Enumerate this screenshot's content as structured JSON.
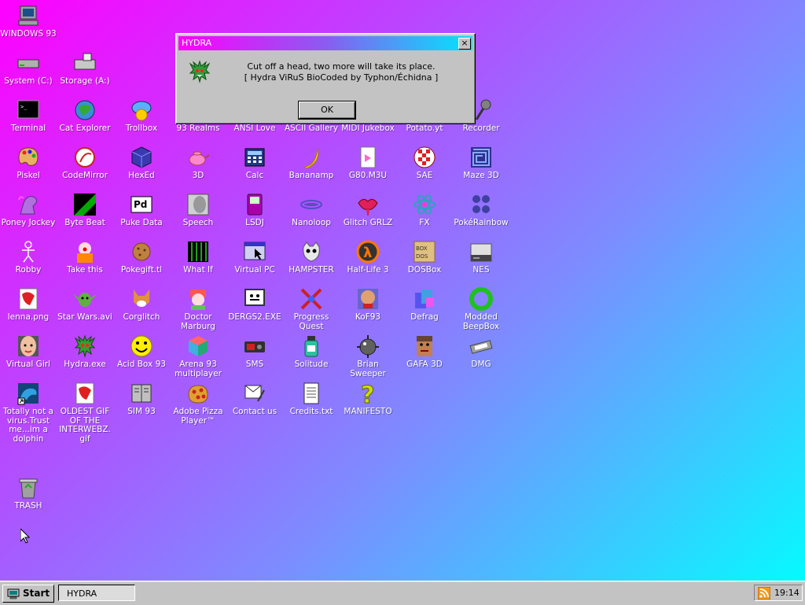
{
  "desktop": {
    "icons": [
      {
        "label": "WINDOWS 93",
        "icon": "computer-icon",
        "color": "#9aa0a6"
      },
      {
        "label": "System (C:)",
        "icon": "hard-drive-icon",
        "color": "#b0b0b0"
      },
      {
        "label": "Storage (A:)",
        "icon": "floppy-drive-icon",
        "color": "#c8c8c8"
      },
      {
        "label": "Terminal",
        "icon": "terminal-icon",
        "color": "#000000"
      },
      {
        "label": "Cat Explorer",
        "icon": "cat-globe-icon",
        "color": "#3b8fd9"
      },
      {
        "label": "Trollbox",
        "icon": "chat-bubble-icon",
        "color": "#ffcc00"
      },
      {
        "label": "93 Realms",
        "icon": "realms-icon",
        "color": "#6a5acd"
      },
      {
        "label": "ANSI Love",
        "icon": "ansi-icon",
        "color": "#ff5555"
      },
      {
        "label": "ASCII Gallery",
        "icon": "ascii-icon",
        "color": "#55aa55"
      },
      {
        "label": "MIDI Jukebox",
        "icon": "jukebox-icon",
        "color": "#aa55ff"
      },
      {
        "label": "Potato.yt",
        "icon": "potato-icon",
        "color": "#c89a5a"
      },
      {
        "label": "Recorder",
        "icon": "microphone-icon",
        "color": "#808080"
      },
      {
        "label": "Piskel",
        "icon": "palette-icon",
        "color": "#e8b060"
      },
      {
        "label": "CodeMirror",
        "icon": "codemirror-icon",
        "color": "#ffffff"
      },
      {
        "label": "HexEd",
        "icon": "cube-icon",
        "color": "#3a3ab0"
      },
      {
        "label": "3D",
        "icon": "teapot-icon",
        "color": "#ff88cc"
      },
      {
        "label": "Calc",
        "icon": "calculator-icon",
        "color": "#203a80"
      },
      {
        "label": "Bananamp",
        "icon": "banana-icon",
        "color": "#ffd700"
      },
      {
        "label": "G80.M3U",
        "icon": "music-file-icon",
        "color": "#ff66cc"
      },
      {
        "label": "SAE",
        "icon": "amiga-ball-icon",
        "color": "#e02020"
      },
      {
        "label": "Maze 3D",
        "icon": "maze-icon",
        "color": "#303090"
      },
      {
        "label": "Poney Jockey",
        "icon": "pony-icon",
        "color": "#b070e0"
      },
      {
        "label": "Byte Beat",
        "icon": "bytebeat-icon",
        "color": "#00aa00"
      },
      {
        "label": "Puke Data",
        "icon": "pd-icon",
        "color": "#ffffff"
      },
      {
        "label": "Speech",
        "icon": "face-icon",
        "color": "#d0d0d0"
      },
      {
        "label": "LSDJ",
        "icon": "gameboy-icon",
        "color": "#aa00aa"
      },
      {
        "label": "Nanoloop",
        "icon": "nanoloop-icon",
        "color": "#5050c0"
      },
      {
        "label": "Glitch GRLZ",
        "icon": "lips-icon",
        "color": "#e0205a"
      },
      {
        "label": "FX",
        "icon": "atom-icon",
        "color": "#30a0c0"
      },
      {
        "label": "PokéRainbow",
        "icon": "pokemon-icon",
        "color": "#4040a0"
      },
      {
        "label": "Robby",
        "icon": "stick-figure-icon",
        "color": "#ffffff"
      },
      {
        "label": "Take this",
        "icon": "clown-icon",
        "color": "#ff8800"
      },
      {
        "label": "Pokegift.tl",
        "icon": "cookie-icon",
        "color": "#c08040"
      },
      {
        "label": "What If",
        "icon": "matrix-icon",
        "color": "#20a020"
      },
      {
        "label": "Virtual PC",
        "icon": "window-cursor-icon",
        "color": "#d0d0f0"
      },
      {
        "label": "HAMPSTER",
        "icon": "hamster-icon",
        "color": "#e8e8e8"
      },
      {
        "label": "Half-Life 3",
        "icon": "lambda-icon",
        "color": "#ff7700"
      },
      {
        "label": "DOSBox",
        "icon": "dosbox-icon",
        "color": "#e0c080"
      },
      {
        "label": "NES",
        "icon": "nes-icon",
        "color": "#e0e0e0"
      },
      {
        "label": "lenna.png",
        "icon": "image-file-icon",
        "color": "#e02020"
      },
      {
        "label": "Star Wars.avi",
        "icon": "yoda-icon",
        "color": "#60b040"
      },
      {
        "label": "Corglitch",
        "icon": "corgi-icon",
        "color": "#e09040"
      },
      {
        "label": "Doctor Marburg",
        "icon": "doctor-icon",
        "color": "#60c060"
      },
      {
        "label": "DERGS2.EXE",
        "icon": "monitor-face-icon",
        "color": "#ffffff"
      },
      {
        "label": "Progress Quest",
        "icon": "swords-icon",
        "color": "#cc2020"
      },
      {
        "label": "KoF93",
        "icon": "fighter-icon",
        "color": "#e0a070"
      },
      {
        "label": "Defrag",
        "icon": "defrag-icon",
        "color": "#40a0e0"
      },
      {
        "label": "Modded BeepBox",
        "icon": "ring-icon",
        "color": "#20c020"
      },
      {
        "label": "Virtual Girl",
        "icon": "girl-face-icon",
        "color": "#f0c0a0"
      },
      {
        "label": "Hydra.exe",
        "icon": "hydra-icon",
        "color": "#30a030"
      },
      {
        "label": "Acid Box 93",
        "icon": "smiley-icon",
        "color": "#ffee00"
      },
      {
        "label": "Arena 93 multiplayer",
        "icon": "arena-cube-icon",
        "color": "#40b0e0"
      },
      {
        "label": "SMS",
        "icon": "sms-icon",
        "color": "#303030"
      },
      {
        "label": "Solitude",
        "icon": "bottle-icon",
        "color": "#30c0a0"
      },
      {
        "label": "Brian Sweeper",
        "icon": "mine-icon",
        "color": "#606060"
      },
      {
        "label": "GAFA 3D",
        "icon": "doom-face-icon",
        "color": "#c08050"
      },
      {
        "label": "DMG",
        "icon": "cassette-icon",
        "color": "#a0a0a0"
      },
      {
        "label": "Totally not a virus.Trust me...im a dolphin",
        "icon": "dolphin-icon",
        "color": "#30a0e0"
      },
      {
        "label": "OLDEST GIF OF THE INTERWEBZ.gif",
        "icon": "gif-file-icon",
        "color": "#e02020"
      },
      {
        "label": "SIM 93",
        "icon": "book-icon",
        "color": "#c0c0c0"
      },
      {
        "label": "Adobe Pizza Player™",
        "icon": "pizza-icon",
        "color": "#e0a030"
      },
      {
        "label": "Contact us",
        "icon": "contact-icon",
        "color": "#ffffff"
      },
      {
        "label": "Credits.txt",
        "icon": "text-file-icon",
        "color": "#ffffff"
      },
      {
        "label": "MANIFESTO",
        "icon": "question-icon",
        "color": "#ccdd00"
      },
      {
        "label": "TRASH",
        "icon": "recycle-bin-icon",
        "color": "#a0a0a0"
      }
    ]
  },
  "dialog": {
    "title": "HYDRA",
    "close_label": "×",
    "line1": "Cut off a head, two more will take its place.",
    "line2": "[ Hydra ViRuS BioCoded by Typhon/Échidna ]",
    "ok_label": "OK"
  },
  "taskbar": {
    "start_label": "Start",
    "task_label": "HYDRA",
    "clock": "19:14"
  }
}
